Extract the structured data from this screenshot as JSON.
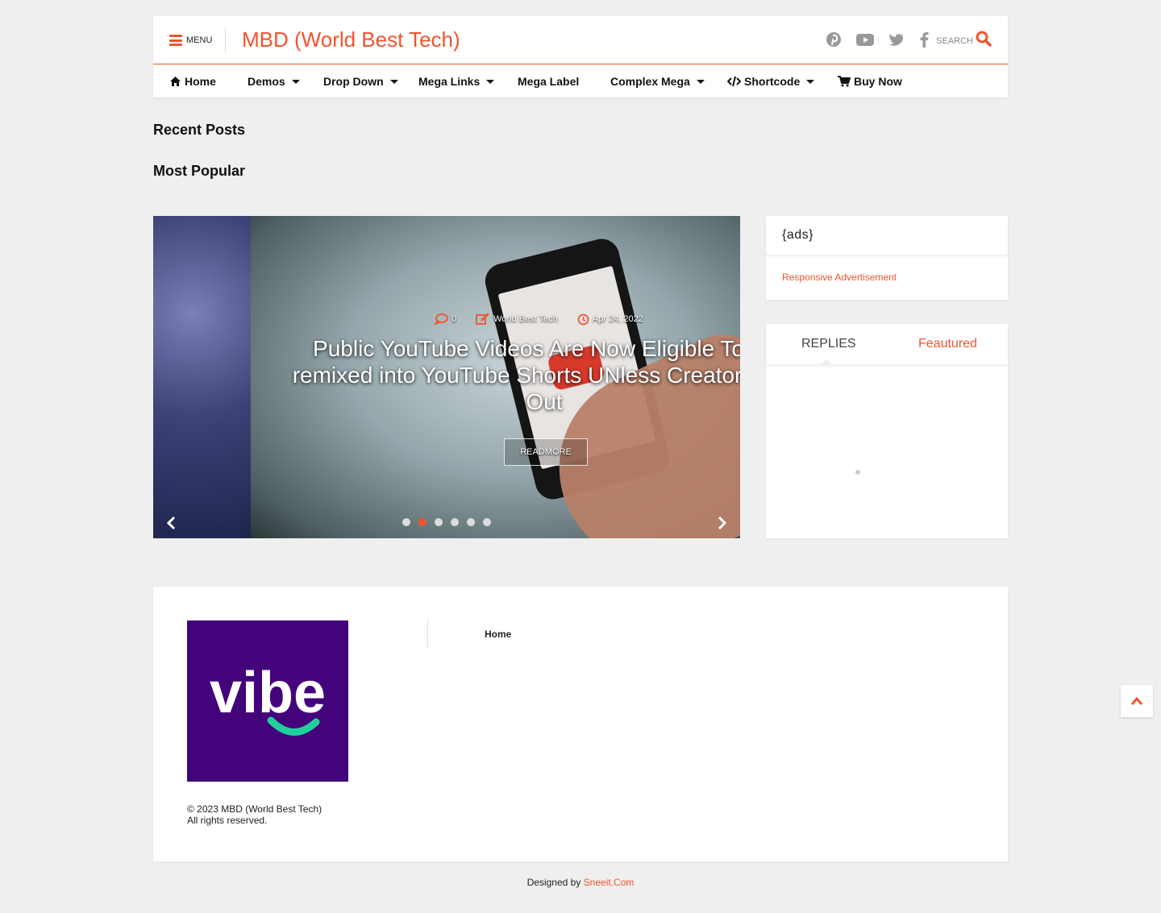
{
  "header": {
    "menu_label": "MENU",
    "site_title": "MBD (World Best Tech)",
    "search_label": "SEARCH",
    "social_icons": [
      "pinterest-icon",
      "youtube-icon",
      "twitter-icon",
      "facebook-icon"
    ]
  },
  "nav": {
    "items": [
      {
        "label": "Home",
        "icon": "home-icon",
        "has_dropdown": false
      },
      {
        "label": "Demos",
        "has_dropdown": true
      },
      {
        "label": "Drop Down",
        "has_dropdown": true
      },
      {
        "label": "Mega Links",
        "has_dropdown": true
      },
      {
        "label": "Mega Label",
        "has_dropdown": false
      },
      {
        "label": "Complex Mega",
        "has_dropdown": true
      },
      {
        "label": "Shortcode",
        "icon": "code-icon",
        "has_dropdown": true
      },
      {
        "label": "Buy Now",
        "icon": "cart-icon",
        "has_dropdown": false
      }
    ]
  },
  "sections": {
    "recent_posts": "Recent Posts",
    "most_popular": "Most Popular"
  },
  "slider": {
    "comments": "0",
    "author": "World Best Tech",
    "date": "Apr 24, 2022",
    "title": "Public YouTube Videos Are Now Eligible To be remixed into YouTube Shorts UNless Creators Opt Out",
    "readmore": "READMORE",
    "slide_count": 6,
    "active_slide": 2
  },
  "sidebar": {
    "ads_title": "{ads}",
    "ads_text": "Responsive Advertisement",
    "tabs": [
      "REPLIES",
      "Feautured"
    ],
    "active_tab": 0
  },
  "footer": {
    "logo_text": "vibe",
    "links": [
      "Home"
    ],
    "copyright_line1": "© 2023 MBD (World Best Tech)",
    "copyright_line2": "All rights reserved."
  },
  "credits": {
    "prefix": "Designed by",
    "link": "Sneeit.Com"
  },
  "colors": {
    "accent": "#f0542d",
    "background": "#efefef",
    "logo_bg": "#43047b",
    "logo_smile": "#1fd09b"
  }
}
